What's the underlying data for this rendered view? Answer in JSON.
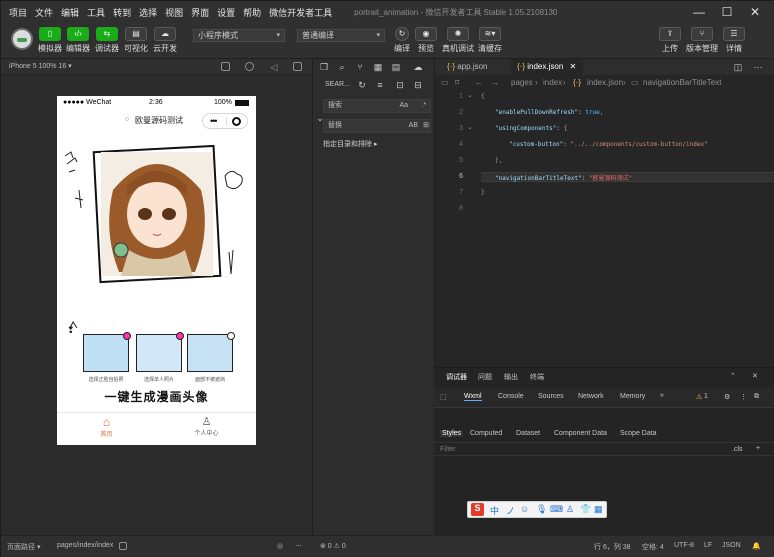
{
  "menubar": {
    "items": [
      "项目",
      "文件",
      "编辑",
      "工具",
      "转到",
      "选择",
      "视图",
      "界面",
      "设置",
      "帮助",
      "微信开发者工具"
    ],
    "title": "portrait_animation - 微信开发者工具 Stable 1.05.2108130"
  },
  "toolbar": {
    "buttons": [
      "模拟器",
      "编辑器",
      "调试器",
      "可视化",
      "云开发"
    ],
    "mode_select": "小程序模式",
    "compile_select": "普通编译",
    "right_buttons": [
      "编译",
      "预览",
      "真机调试",
      "清缓存"
    ],
    "far_right_buttons": [
      "上传",
      "版本管理",
      "详情"
    ]
  },
  "simbar": {
    "device": "iPhone 5 100% 16 ▾"
  },
  "phone": {
    "status_signal": "●●●●● WeChat",
    "status_time": "2:36",
    "status_battery": "100%",
    "nav_title": "欧曼源码测试",
    "sample_labels": [
      "选择正脸自拍照",
      "选择单人照片",
      "面部不被遮挡"
    ],
    "big_title": "一键生成漫画头像",
    "tabs": [
      "首页",
      "个人中心"
    ]
  },
  "leftstatus": {
    "path_label": "页面路径 ▾",
    "path": "pages/index/index"
  },
  "search": {
    "title": "SEAR...",
    "search_placeholder": "搜索",
    "replace_placeholder": "替换",
    "aa_label": "Aa",
    "ab_label": "AB",
    "include_label": "指定目录和排除 ▸"
  },
  "editor": {
    "tabs": [
      {
        "icon": "{·}",
        "label": "app.json"
      },
      {
        "icon": "{·}",
        "label": "index.json"
      }
    ],
    "breadcrumb": [
      "pages",
      "index",
      "index.json",
      "navigationBarTitleText"
    ],
    "line_numbers": [
      "1",
      "2",
      "3",
      "4",
      "5",
      "6",
      "7",
      "8"
    ],
    "code": {
      "l2_key": "\"enablePullDownRefresh\"",
      "l2_val": "true,",
      "l3_key": "\"usingComponents\"",
      "l3_val": "{",
      "l4_key": "\"custom-button\"",
      "l4_val": "\"../../components/custom-button/index\"",
      "l5": "},",
      "l6_key": "\"navigationBarTitleText\"",
      "l6_val": "\"欧曼源码测试\"",
      "l1": "{",
      "l7": "}"
    }
  },
  "devtools": {
    "top_tabs": [
      "调试器",
      "问题",
      "输出",
      "终端"
    ],
    "tabs": [
      "Wxml",
      "Console",
      "Sources",
      "Network",
      "Memory"
    ],
    "more": "»",
    "warn_count": "1",
    "panel_tabs": [
      "Styles",
      "Computed",
      "Dataset",
      "Component Data",
      "Scope Data"
    ],
    "filter_placeholder": "Filter",
    "cls": ".cls",
    "plus": "+"
  },
  "ime": {
    "items": [
      "中",
      "ノ",
      "☺",
      "⌨",
      "👕",
      "▦"
    ]
  },
  "rightstatus": {
    "errors": "⊗ 0 ⚠ 0",
    "position": "行 6，列 38",
    "spaces": "空格: 4",
    "encoding": "UTF-8",
    "eol": "LF",
    "lang": "JSON"
  },
  "colors": {
    "accent_green": "#1aad19",
    "tab_active": "#ffffff",
    "ime_red": "#e03c28"
  }
}
